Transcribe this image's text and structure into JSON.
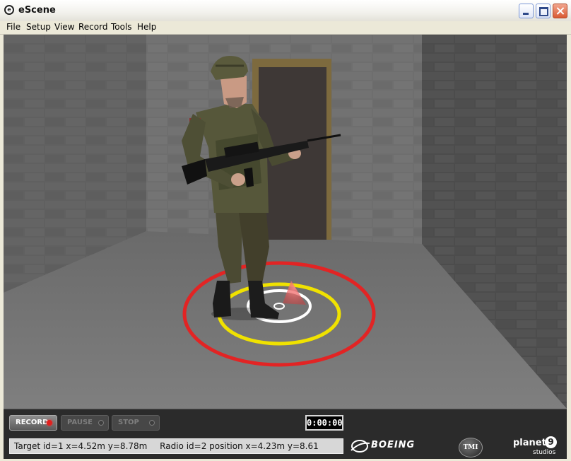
{
  "window": {
    "title": "eScene"
  },
  "menu": {
    "items": [
      "File",
      "Setup",
      "View",
      "Record",
      "Tools",
      "Help"
    ]
  },
  "controls": {
    "record_label": "RECORD",
    "pause_label": "PAUSE",
    "stop_label": "STOP",
    "timer": "0:00:00"
  },
  "status": {
    "target": "Target id=1 x=4.52m y=8.78m",
    "radio": "Radio id=2 position x=4.23m y=8.61"
  },
  "logos": {
    "boeing": "BOEING",
    "tmi": "TMI",
    "planet_name": "planet",
    "planet_number": "9",
    "planet_sub": "studios"
  },
  "colors": {
    "accent_record": "#e0201e",
    "ring_outer": "#e22424",
    "ring_middle": "#f0e200",
    "ring_inner": "#ffffff"
  }
}
